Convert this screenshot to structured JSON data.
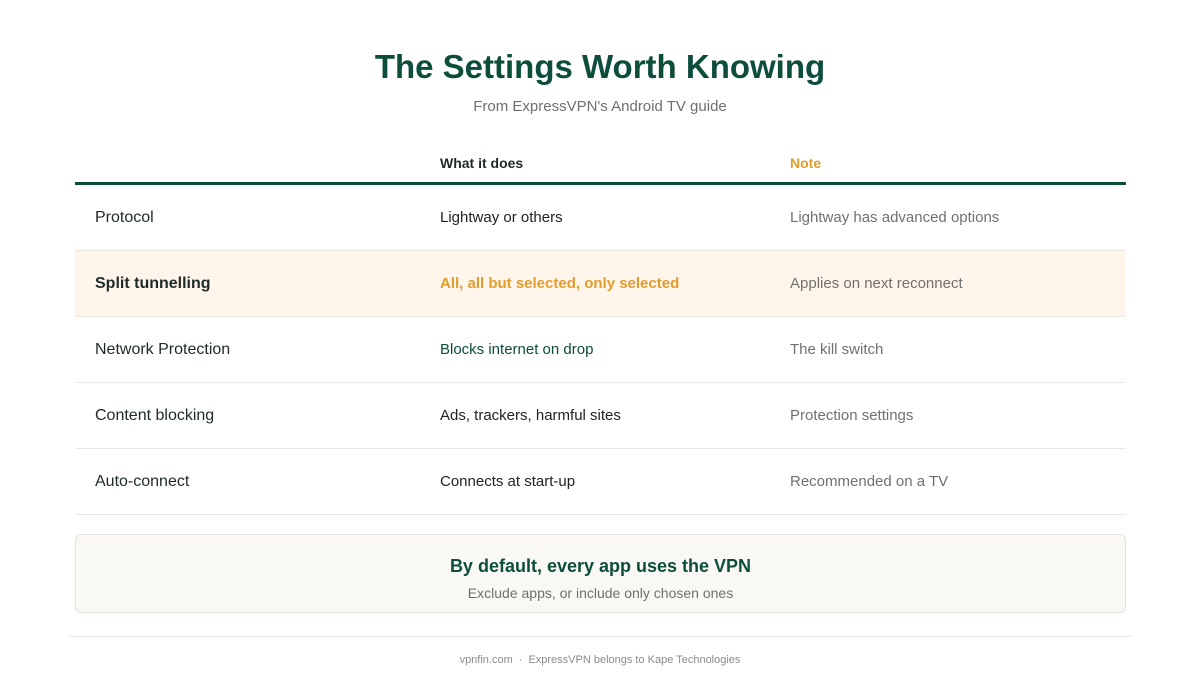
{
  "header": {
    "title": "The Settings Worth Knowing",
    "subtitle": "From ExpressVPN's Android TV guide"
  },
  "table": {
    "columns": [
      "",
      "What it does",
      "Note"
    ],
    "rows": [
      {
        "setting": "Protocol",
        "what": "Lightway or others",
        "note": "Lightway has advanced options",
        "highlight": false
      },
      {
        "setting": "Split tunnelling",
        "what": "All, all but selected, only selected",
        "note": "Applies on next reconnect",
        "highlight": true
      },
      {
        "setting": "Network Protection",
        "what": "Blocks internet on drop",
        "note": "The kill switch",
        "highlight": false
      },
      {
        "setting": "Content blocking",
        "what": "Ads, trackers, harmful sites",
        "note": "Protection settings",
        "highlight": false
      },
      {
        "setting": "Auto-connect",
        "what": "Connects at start-up",
        "note": "Recommended on a TV",
        "highlight": false
      }
    ]
  },
  "callout": {
    "title": "By default, every app uses the VPN",
    "subtitle": "Exclude apps, or include only chosen ones"
  },
  "footer": {
    "site": "vpnfin.com",
    "separator": "·",
    "note": "ExpressVPN belongs to Kape Technologies"
  },
  "colors": {
    "brand_green": "#0d4d3b",
    "accent_orange": "#e39d2b",
    "highlight_row": "#fff5eb"
  }
}
